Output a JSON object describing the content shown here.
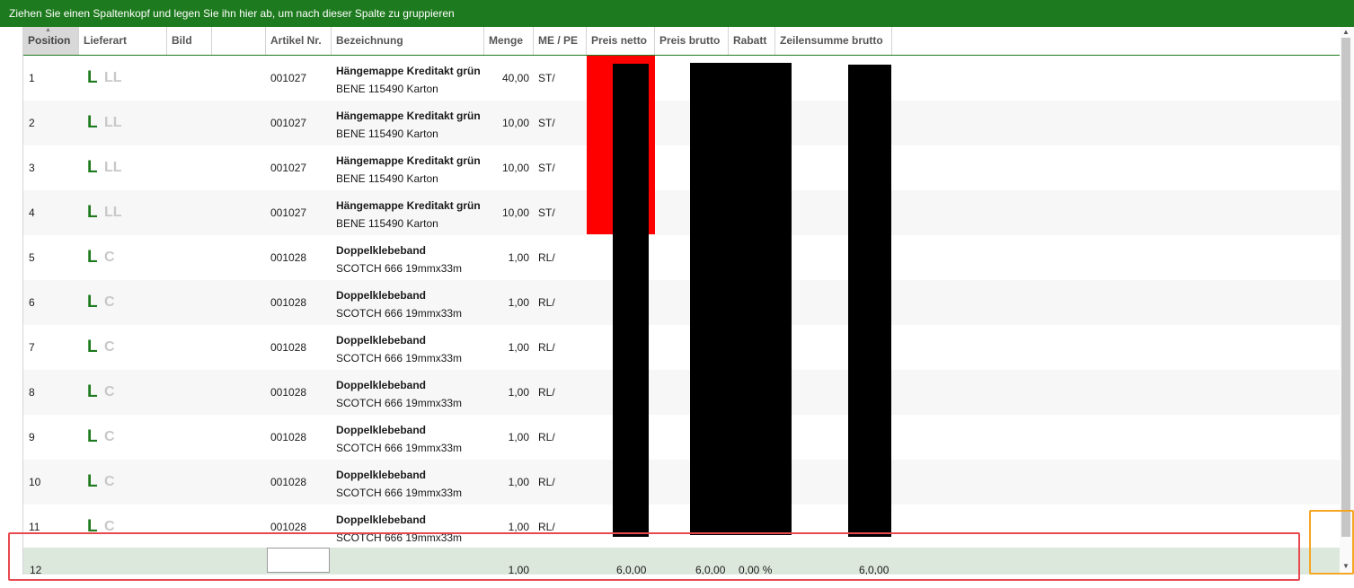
{
  "group_bar": {
    "text": "Ziehen Sie einen Spaltenkopf und legen Sie ihn hier ab, um nach dieser Spalte zu gruppieren"
  },
  "columns": {
    "position": "Position",
    "lieferart": "Lieferart",
    "bild": "Bild",
    "blank": "",
    "artikel_nr": "Artikel Nr.",
    "bezeichnung": "Bezeichnung",
    "menge": "Menge",
    "me_pe": "ME / PE",
    "preis_netto": "Preis netto",
    "preis_brutto": "Preis brutto",
    "rabatt": "Rabatt",
    "zeilensumme_brutto": "Zeilensumme brutto"
  },
  "rows": [
    {
      "position": "1",
      "lief_main": "L",
      "lief_sub": "LL",
      "artikel_nr": "001027",
      "desc1": "Hängemappe Kreditakt grün",
      "desc2": "BENE 115490 Karton",
      "menge": "40,00",
      "me": "ST/"
    },
    {
      "position": "2",
      "lief_main": "L",
      "lief_sub": "LL",
      "artikel_nr": "001027",
      "desc1": "Hängemappe Kreditakt grün",
      "desc2": "BENE 115490 Karton",
      "menge": "10,00",
      "me": "ST/"
    },
    {
      "position": "3",
      "lief_main": "L",
      "lief_sub": "LL",
      "artikel_nr": "001027",
      "desc1": "Hängemappe Kreditakt grün",
      "desc2": "BENE 115490 Karton",
      "menge": "10,00",
      "me": "ST/"
    },
    {
      "position": "4",
      "lief_main": "L",
      "lief_sub": "LL",
      "artikel_nr": "001027",
      "desc1": "Hängemappe Kreditakt grün",
      "desc2": "BENE 115490 Karton",
      "menge": "10,00",
      "me": "ST/"
    },
    {
      "position": "5",
      "lief_main": "L",
      "lief_sub": "C",
      "artikel_nr": "001028",
      "desc1": "Doppelklebeband",
      "desc2": "SCOTCH 666 19mmx33m",
      "menge": "1,00",
      "me": "RL/"
    },
    {
      "position": "6",
      "lief_main": "L",
      "lief_sub": "C",
      "artikel_nr": "001028",
      "desc1": "Doppelklebeband",
      "desc2": "SCOTCH 666 19mmx33m",
      "menge": "1,00",
      "me": "RL/"
    },
    {
      "position": "7",
      "lief_main": "L",
      "lief_sub": "C",
      "artikel_nr": "001028",
      "desc1": "Doppelklebeband",
      "desc2": "SCOTCH 666 19mmx33m",
      "menge": "1,00",
      "me": "RL/"
    },
    {
      "position": "8",
      "lief_main": "L",
      "lief_sub": "C",
      "artikel_nr": "001028",
      "desc1": "Doppelklebeband",
      "desc2": "SCOTCH 666 19mmx33m",
      "menge": "1,00",
      "me": "RL/"
    },
    {
      "position": "9",
      "lief_main": "L",
      "lief_sub": "C",
      "artikel_nr": "001028",
      "desc1": "Doppelklebeband",
      "desc2": "SCOTCH 666 19mmx33m",
      "menge": "1,00",
      "me": "RL/"
    },
    {
      "position": "10",
      "lief_main": "L",
      "lief_sub": "C",
      "artikel_nr": "001028",
      "desc1": "Doppelklebeband",
      "desc2": "SCOTCH 666 19mmx33m",
      "menge": "1,00",
      "me": "RL/"
    },
    {
      "position": "11",
      "lief_main": "L",
      "lief_sub": "C",
      "artikel_nr": "001028",
      "desc1": "Doppelklebeband",
      "desc2": "SCOTCH 666 19mmx33m",
      "menge": "1,00",
      "me": "RL/"
    }
  ],
  "new_row": {
    "position": "12",
    "menge": "1,00",
    "preis_netto": "6,0,00",
    "preis_brutto": "6,0,00",
    "rabatt": "0,00 %",
    "zeilensumme": "6,0,00"
  },
  "icons": {
    "sort": "sort-ascending-icon",
    "scroll_up": "scroll-up-arrow-icon",
    "scroll_down": "scroll-down-arrow-icon"
  },
  "colors": {
    "group_bar": "#1e7a1e",
    "lieferart_l": "#1e7a1e",
    "highlight_price": "#ff0000",
    "redacted": "#000000",
    "new_row": "#dde8dd"
  }
}
